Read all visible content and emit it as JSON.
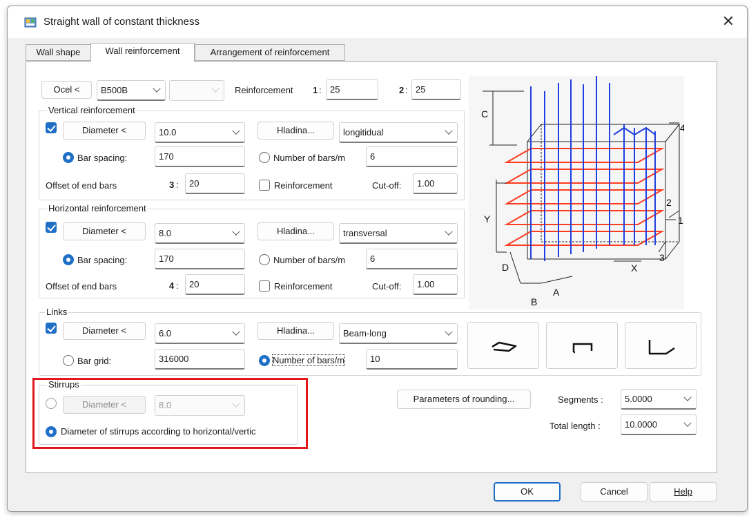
{
  "window": {
    "title": "Straight wall of constant thickness",
    "close_glyph": "✕"
  },
  "tabs": [
    {
      "label": "Wall shape",
      "active": false
    },
    {
      "label": "Wall reinforcement",
      "active": true
    },
    {
      "label": "Arrangement of reinforcement",
      "active": false
    }
  ],
  "steel": {
    "button": "Ocel <",
    "grade": "B500B",
    "grade2": "",
    "reinforcement_label": "Reinforcement",
    "cover1_label": "1",
    "cover1_value": "25",
    "cover2_label": "2",
    "cover2_value": "25"
  },
  "vertical": {
    "title": "Vertical reinforcement",
    "checked": true,
    "diameter_button": "Diameter <",
    "diameter_value": "10.0",
    "layer_button": "Hladina...",
    "layer_value": "longitidual",
    "bar_spacing_label": "Bar spacing:",
    "bar_spacing_value": "170",
    "number_label": "Number of bars/m",
    "number_value": "6",
    "offset_label": "Offset of end bars",
    "offset_key": "3",
    "offset_value": "20",
    "reinf_label": "Reinforcement",
    "cutoff_label": "Cut-off:",
    "cutoff_value": "1.00"
  },
  "horizontal": {
    "title": "Horizontal reinforcement",
    "checked": true,
    "diameter_button": "Diameter <",
    "diameter_value": "8.0",
    "layer_button": "Hladina...",
    "layer_value": "transversal",
    "bar_spacing_label": "Bar spacing:",
    "bar_spacing_value": "170",
    "number_label": "Number of bars/m",
    "number_value": "6",
    "offset_label": "Offset of end bars",
    "offset_key": "4",
    "offset_value": "20",
    "reinf_label": "Reinforcement",
    "cutoff_label": "Cut-off:",
    "cutoff_value": "1.00"
  },
  "links": {
    "title": "Links",
    "checked": true,
    "diameter_button": "Diameter <",
    "diameter_value": "6.0",
    "layer_button": "Hladina...",
    "layer_value": "Beam-long",
    "bar_grid_label": "Bar grid:",
    "bar_grid_value": "316000",
    "number_label": "Number of bars/m",
    "number_value": "10"
  },
  "stirrups": {
    "title": "Stirrups",
    "diameter_button": "Diameter <",
    "diameter_value": "8.0",
    "according_label": "Diameter of stirrups according to horizontal/vertic"
  },
  "rounding": {
    "button": "Parameters of rounding...",
    "segments_label": "Segments :",
    "segments_value": "5.0000",
    "total_label": "Total length :",
    "total_value": "10.0000"
  },
  "diagram": {
    "labels": [
      "C",
      "4",
      "Y",
      "2",
      "1",
      "3",
      "X",
      "D",
      "A",
      "B"
    ]
  },
  "footer": {
    "ok": "OK",
    "cancel": "Cancel",
    "help": "Help"
  },
  "colors": {
    "accent": "#1f6fc6",
    "highlight": "#e3161b",
    "rebar_vertical": "#1f3fe0",
    "rebar_horizontal": "#ff3b1f"
  }
}
